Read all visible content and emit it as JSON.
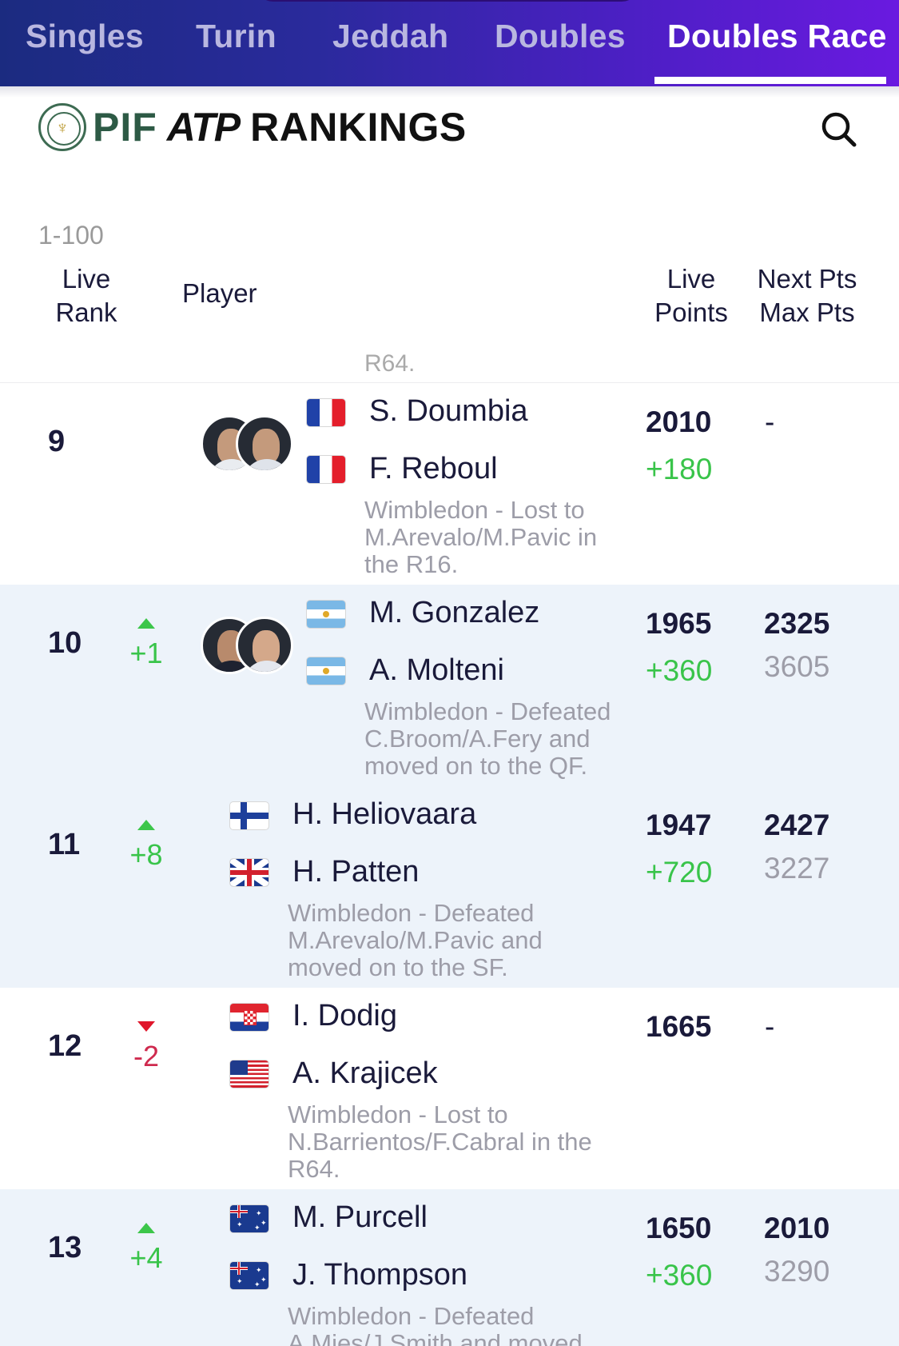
{
  "tabs": [
    "Singles",
    "Turin",
    "Jeddah",
    "Doubles",
    "Doubles Race"
  ],
  "active_tab": "Doubles Race",
  "brand": {
    "pif": "PIF",
    "atp": "ATP",
    "rankings": "RANKINGS"
  },
  "range_label": "1-100",
  "columns": {
    "rank_line1": "Live",
    "rank_line2": "Rank",
    "player": "Player",
    "points_line1": "Live",
    "points_line2": "Points",
    "next_line1": "Next Pts",
    "next_line2": "Max Pts"
  },
  "previous_row_tail": "R64.",
  "rows": [
    {
      "rank": "9",
      "movement": "",
      "direction": "none",
      "players": [
        {
          "name": "S. Doumbia",
          "flag": "france-flag"
        },
        {
          "name": "F. Reboul",
          "flag": "france-flag"
        }
      ],
      "description": [
        "Wimbledon - Lost to",
        "M.Arevalo/M.Pavic in",
        "the R16."
      ],
      "live_points": "2010",
      "points_gain": "+180",
      "next_pts": "-",
      "max_pts": ""
    },
    {
      "rank": "10",
      "movement": "+1",
      "direction": "up",
      "players": [
        {
          "name": "M. Gonzalez",
          "flag": "argentina-flag"
        },
        {
          "name": "A. Molteni",
          "flag": "argentina-flag"
        }
      ],
      "description": [
        "Wimbledon - Defeated",
        "C.Broom/A.Fery and",
        "moved on to the QF."
      ],
      "live_points": "1965",
      "points_gain": "+360",
      "next_pts": "2325",
      "max_pts": "3605"
    },
    {
      "rank": "11",
      "movement": "+8",
      "direction": "up",
      "players": [
        {
          "name": "H. Heliovaara",
          "flag": "finland-flag"
        },
        {
          "name": "H. Patten",
          "flag": "uk-flag"
        }
      ],
      "description": [
        "Wimbledon - Defeated",
        "M.Arevalo/M.Pavic and",
        "moved on to the SF."
      ],
      "live_points": "1947",
      "points_gain": "+720",
      "next_pts": "2427",
      "max_pts": "3227"
    },
    {
      "rank": "12",
      "movement": "-2",
      "direction": "down",
      "players": [
        {
          "name": "I. Dodig",
          "flag": "croatia-flag"
        },
        {
          "name": "A. Krajicek",
          "flag": "usa-flag"
        }
      ],
      "description": [
        "Wimbledon - Lost to",
        "N.Barrientos/F.Cabral in the",
        "R64."
      ],
      "live_points": "1665",
      "points_gain": "",
      "next_pts": "-",
      "max_pts": ""
    },
    {
      "rank": "13",
      "movement": "+4",
      "direction": "up",
      "players": [
        {
          "name": "M. Purcell",
          "flag": "australia-flag"
        },
        {
          "name": "J. Thompson",
          "flag": "australia-flag"
        }
      ],
      "description": [
        "Wimbledon - Defeated",
        "A.Mies/J.Smith and moved"
      ],
      "live_points": "1650",
      "points_gain": "+360",
      "next_pts": "2010",
      "max_pts": "3290"
    }
  ],
  "colors": {
    "gain_green": "#39c44a",
    "drop_red": "#cf2a4e",
    "accent_purple": "#6a1ae0",
    "row_alt": "#edf3fa"
  }
}
